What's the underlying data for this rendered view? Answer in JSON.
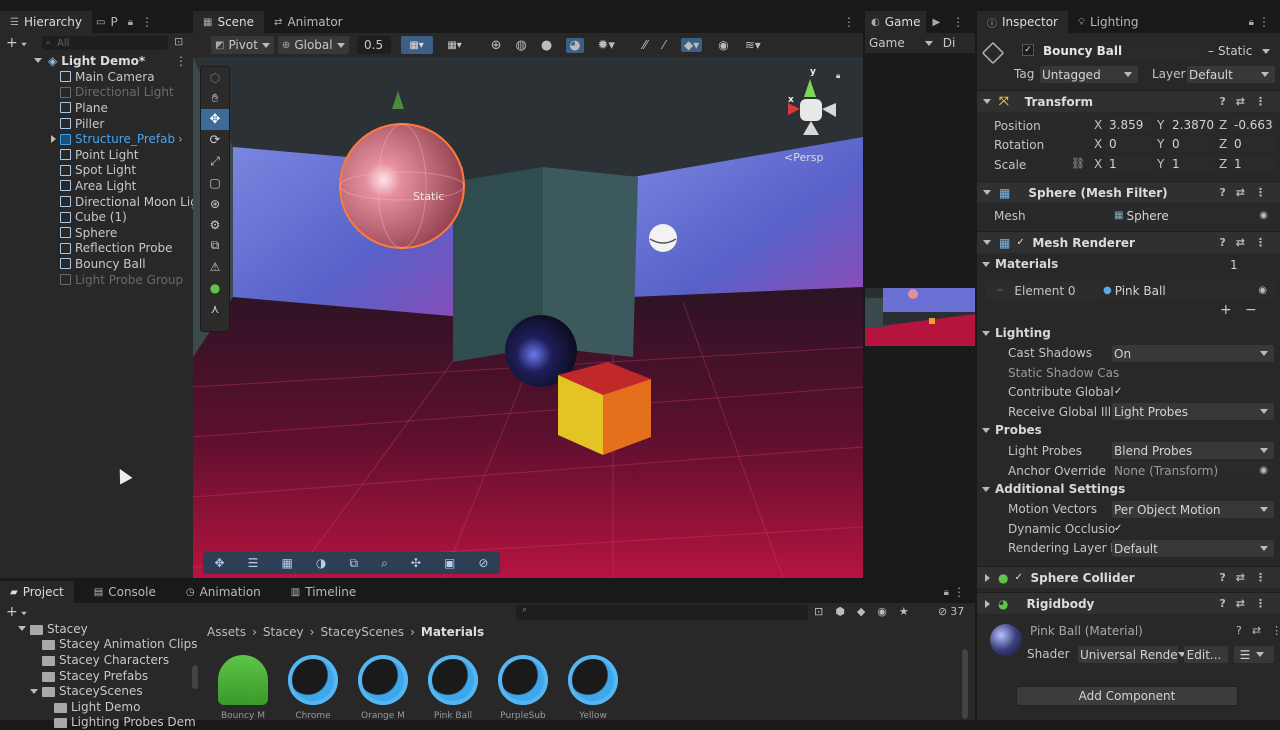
{
  "hierarchy": {
    "tab": "Hierarchy",
    "tab2": "P",
    "search_placeholder": "All",
    "scene_name": "Light Demo*",
    "items": [
      {
        "label": "Main Camera",
        "state": "normal"
      },
      {
        "label": "Directional Light",
        "state": "dim"
      },
      {
        "label": "Plane",
        "state": "normal"
      },
      {
        "label": "Piller",
        "state": "normal"
      },
      {
        "label": "Structure_Prefab",
        "state": "prefab"
      },
      {
        "label": "Point Light",
        "state": "normal"
      },
      {
        "label": "Spot Light",
        "state": "normal"
      },
      {
        "label": "Area Light",
        "state": "normal"
      },
      {
        "label": "Directional Moon Lig",
        "state": "normal"
      },
      {
        "label": "Cube (1)",
        "state": "normal"
      },
      {
        "label": "Sphere",
        "state": "normal"
      },
      {
        "label": "Reflection Probe",
        "state": "normal"
      },
      {
        "label": "Bouncy Ball",
        "state": "normal"
      },
      {
        "label": "Light Probe Group",
        "state": "dim"
      }
    ]
  },
  "scene": {
    "tab_scene": "Scene",
    "tab_animator": "Animator",
    "pivot": "Pivot",
    "global": "Global",
    "snap_value": "0.5",
    "persp_label": "Persp",
    "static_label": "Static",
    "gizmo_y": "y",
    "gizmo_x": "x"
  },
  "game": {
    "tab": "Game",
    "display": "Game",
    "display2": "Di"
  },
  "inspector": {
    "tab_inspector": "Inspector",
    "tab_lighting": "Lighting",
    "object_name": "Bouncy Ball",
    "static_label": "Static",
    "tag_label": "Tag",
    "tag_value": "Untagged",
    "layer_label": "Layer",
    "layer_value": "Default",
    "transform": {
      "title": "Transform",
      "position_label": "Position",
      "rotation_label": "Rotation",
      "scale_label": "Scale",
      "position": {
        "x": "3.859",
        "y": "2.3870",
        "z": "-0.663"
      },
      "rotation": {
        "x": "0",
        "y": "0",
        "z": "0"
      },
      "scale": {
        "x": "1",
        "y": "1",
        "z": "1"
      }
    },
    "mesh_filter": {
      "title": "Sphere (Mesh Filter)",
      "mesh_label": "Mesh",
      "mesh_value": "Sphere"
    },
    "mesh_renderer": {
      "title": "Mesh Renderer",
      "materials_label": "Materials",
      "materials_count": "1",
      "element0_label": "Element 0",
      "element0_value": "Pink Ball",
      "lighting_label": "Lighting",
      "cast_shadows_label": "Cast Shadows",
      "cast_shadows_value": "On",
      "static_shadow_label": "Static Shadow Cas",
      "contribute_gi_label": "Contribute Global",
      "receive_gi_label": "Receive Global Illu",
      "receive_gi_value": "Light Probes",
      "probes_label": "Probes",
      "light_probes_label": "Light Probes",
      "light_probes_value": "Blend Probes",
      "anchor_label": "Anchor Override",
      "anchor_value": "None (Transform)",
      "additional_label": "Additional Settings",
      "motion_vectors_label": "Motion Vectors",
      "motion_vectors_value": "Per Object Motion",
      "dynamic_occl_label": "Dynamic Occlusio",
      "rendering_layer_label": "Rendering Layer M",
      "rendering_layer_value": "Default"
    },
    "sphere_collider": {
      "title": "Sphere Collider"
    },
    "rigidbody": {
      "title": "Rigidbody"
    },
    "material": {
      "title": "Pink Ball (Material)",
      "shader_label": "Shader",
      "shader_value": "Universal Rende",
      "edit_label": "Edit..."
    },
    "add_component": "Add Component"
  },
  "project": {
    "tab_project": "Project",
    "tab_console": "Console",
    "tab_animation": "Animation",
    "tab_timeline": "Timeline",
    "hidden_count": "37",
    "tree": [
      {
        "label": "Stacey",
        "level": 0
      },
      {
        "label": "Stacey Animation Clips",
        "level": 1
      },
      {
        "label": "Stacey Characters",
        "level": 1
      },
      {
        "label": "Stacey Prefabs",
        "level": 1
      },
      {
        "label": "StaceyScenes",
        "level": 1
      },
      {
        "label": "Light Demo",
        "level": 2
      },
      {
        "label": "Lighting Probes Dem",
        "level": 2
      }
    ],
    "breadcrumb": [
      "Assets",
      "Stacey",
      "StaceyScenes",
      "Materials"
    ],
    "assets": [
      "Bouncy M",
      "Chrome",
      "Orange M",
      "Pink Ball",
      "PurpleSub",
      "Yellow"
    ]
  },
  "colors": {
    "accent": "#3d8fd6",
    "panel": "#282828",
    "header": "#191919",
    "sky": "#6a6fd4",
    "floor": "#a0103c",
    "pink_ball": "#e06d82",
    "cube_yellow": "#e0c020"
  }
}
